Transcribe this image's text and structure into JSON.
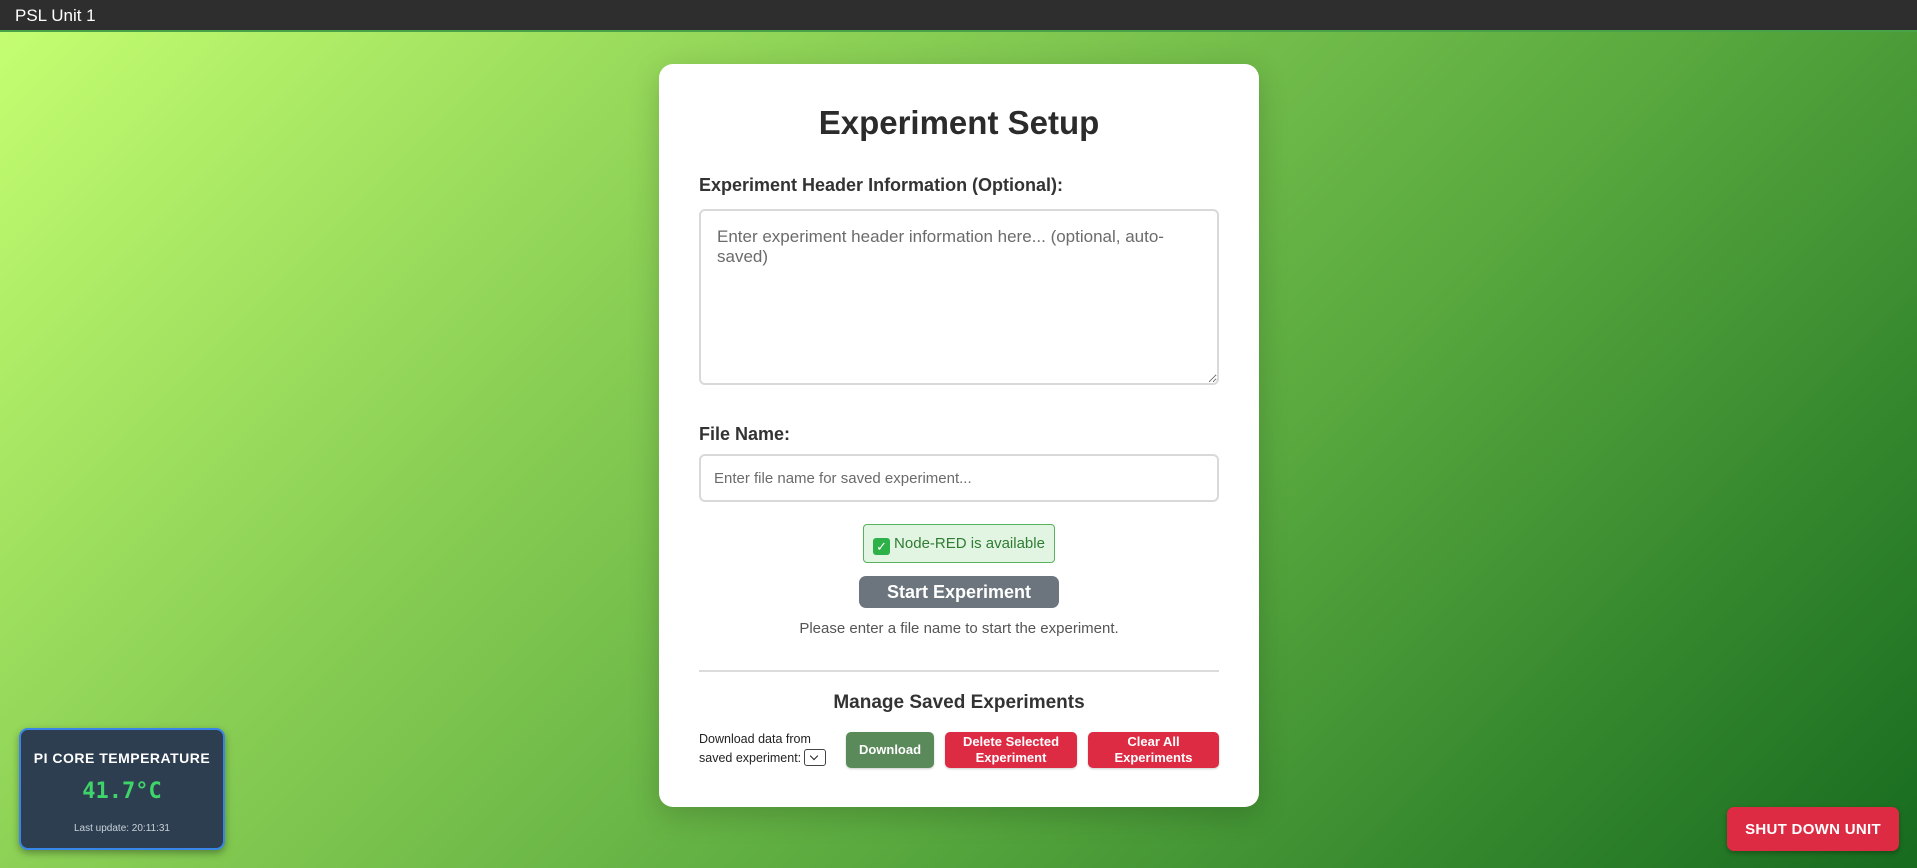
{
  "topbar": {
    "title": "PSL Unit 1"
  },
  "setup": {
    "title": "Experiment Setup",
    "header_label": "Experiment Header Information (Optional):",
    "header_placeholder": "Enter experiment header information here... (optional, auto-saved)",
    "file_label": "File Name:",
    "file_placeholder": "Enter file name for saved experiment...",
    "status_text": "Node-RED is available",
    "status_icon": "check-mark-icon",
    "start_button": "Start Experiment",
    "hint": "Please enter a file name to start the experiment."
  },
  "manage": {
    "title": "Manage Saved Experiments",
    "download_label": "Download data from saved experiment:",
    "download_button": "Download",
    "delete_button": "Delete Selected Experiment",
    "clear_button": "Clear All Experiments"
  },
  "temperature": {
    "title": "PI CORE TEMPERATURE",
    "value": "41.7°C",
    "last_update": "Last update: 20:11:31"
  },
  "shutdown": {
    "label": "SHUT DOWN UNIT"
  },
  "colors": {
    "accent_green": "#2fb14a",
    "danger_red": "#dc2b43",
    "start_gray": "#6c757d",
    "download_green": "#5a8a5a",
    "temp_value_green": "#3fd46a"
  }
}
